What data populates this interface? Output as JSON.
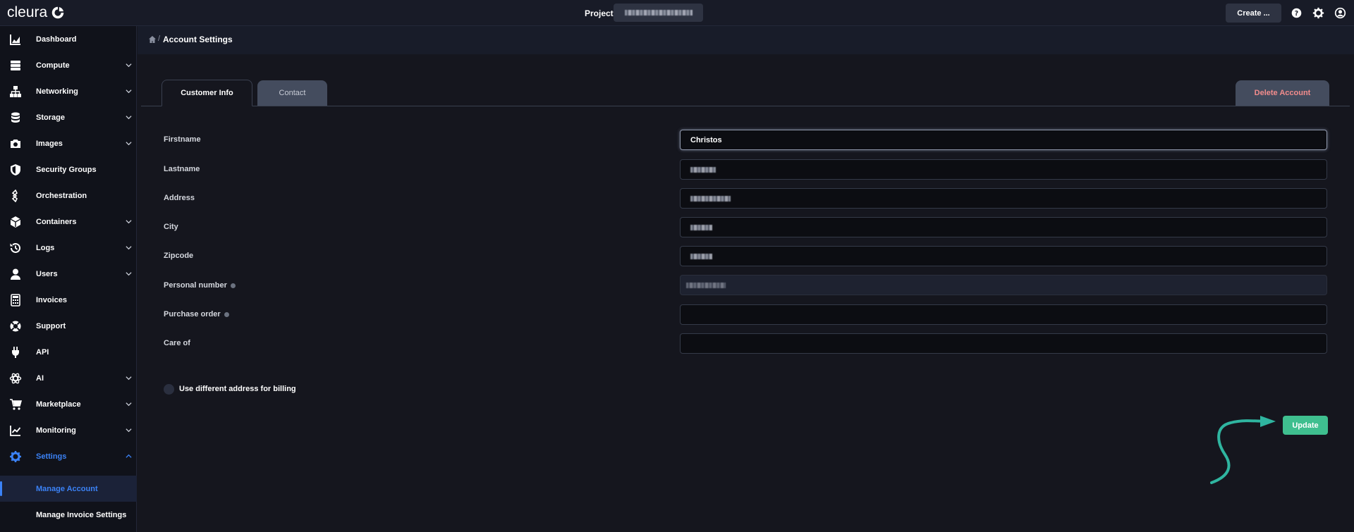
{
  "topbar": {
    "brand": "cleura",
    "project_label": "Project",
    "create_label": "Create ..."
  },
  "sidebar": {
    "items": [
      {
        "label": "Dashboard",
        "icon": "chart-area-icon",
        "expandable": false
      },
      {
        "label": "Compute",
        "icon": "server-icon",
        "expandable": true
      },
      {
        "label": "Networking",
        "icon": "network-icon",
        "expandable": true
      },
      {
        "label": "Storage",
        "icon": "database-icon",
        "expandable": true
      },
      {
        "label": "Images",
        "icon": "camera-icon",
        "expandable": true
      },
      {
        "label": "Security Groups",
        "icon": "shield-icon",
        "expandable": false
      },
      {
        "label": "Orchestration",
        "icon": "orchestration-icon",
        "expandable": false
      },
      {
        "label": "Containers",
        "icon": "cube-icon",
        "expandable": true
      },
      {
        "label": "Logs",
        "icon": "history-icon",
        "expandable": true
      },
      {
        "label": "Users",
        "icon": "user-icon",
        "expandable": true
      },
      {
        "label": "Invoices",
        "icon": "calculator-icon",
        "expandable": false
      },
      {
        "label": "Support",
        "icon": "lifebuoy-icon",
        "expandable": false
      },
      {
        "label": "API",
        "icon": "plug-icon",
        "expandable": false
      },
      {
        "label": "AI",
        "icon": "ai-icon",
        "expandable": true
      },
      {
        "label": "Marketplace",
        "icon": "cart-icon",
        "expandable": true
      },
      {
        "label": "Monitoring",
        "icon": "line-chart-icon",
        "expandable": true
      },
      {
        "label": "Settings",
        "icon": "gear-icon",
        "expandable": true,
        "active": true
      }
    ],
    "sub_items": [
      {
        "label": "Manage Account",
        "current": true
      },
      {
        "label": "Manage Invoice Settings",
        "current": false
      }
    ]
  },
  "breadcrumb": {
    "separator": "/",
    "title": "Account Settings"
  },
  "tabs": {
    "customer_info": "Customer Info",
    "contact": "Contact",
    "delete_account": "Delete Account"
  },
  "form": {
    "fields": [
      {
        "label": "Firstname",
        "value": "Christos",
        "info": false
      },
      {
        "label": "Lastname",
        "value": "",
        "info": false
      },
      {
        "label": "Address",
        "value": "",
        "info": false
      },
      {
        "label": "City",
        "value": "",
        "info": false
      },
      {
        "label": "Zipcode",
        "value": "",
        "info": false
      },
      {
        "label": "Personal number",
        "value": "",
        "info": true
      },
      {
        "label": "Purchase order",
        "value": "",
        "info": true
      },
      {
        "label": "Care of",
        "value": "",
        "info": false
      }
    ],
    "billing_toggle_label": "Use different address for billing",
    "update_label": "Update"
  },
  "colors": {
    "accent_blue": "#3b82f6",
    "update_green": "#3fbf8f",
    "arrow_teal": "#2fb5a0",
    "delete_red": "#f28c8c"
  }
}
